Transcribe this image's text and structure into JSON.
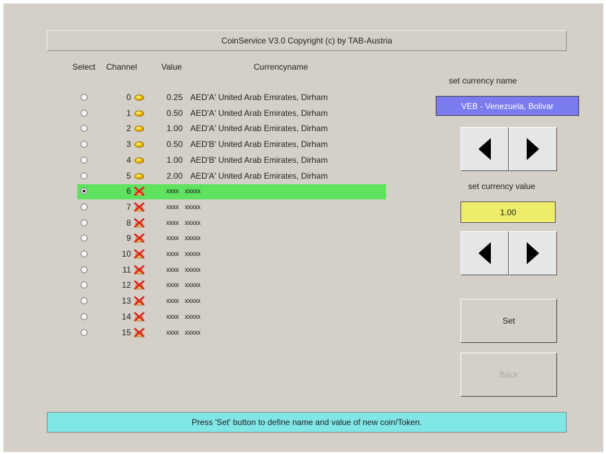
{
  "title": "CoinService V3.0 Copyright (c) by TAB-Austria",
  "columns": {
    "select": "Select",
    "channel": "Channel",
    "value": "Value",
    "currencyname": "Currencyname"
  },
  "selected_channel": 6,
  "channels": [
    {
      "channel": "0",
      "status": "coin",
      "value": "0.25",
      "currency": "AED'A' United Arab Emirates, Dirham"
    },
    {
      "channel": "1",
      "status": "coin",
      "value": "0.50",
      "currency": "AED'A' United Arab Emirates, Dirham"
    },
    {
      "channel": "2",
      "status": "coin",
      "value": "1.00",
      "currency": "AED'A' United Arab Emirates, Dirham"
    },
    {
      "channel": "3",
      "status": "coin",
      "value": "0.50",
      "currency": "AED'B' United Arab Emirates, Dirham"
    },
    {
      "channel": "4",
      "status": "coin",
      "value": "1.00",
      "currency": "AED'B' United Arab Emirates, Dirham"
    },
    {
      "channel": "5",
      "status": "coin",
      "value": "2.00",
      "currency": "AED'A' United Arab Emirates, Dirham"
    },
    {
      "channel": "6",
      "status": "empty",
      "value": "xxxx",
      "currency": "xxxxx"
    },
    {
      "channel": "7",
      "status": "empty",
      "value": "xxxx",
      "currency": "xxxxx"
    },
    {
      "channel": "8",
      "status": "empty",
      "value": "xxxx",
      "currency": "xxxxx"
    },
    {
      "channel": "9",
      "status": "empty",
      "value": "xxxx",
      "currency": "xxxxx"
    },
    {
      "channel": "10",
      "status": "empty",
      "value": "xxxx",
      "currency": "xxxxx"
    },
    {
      "channel": "11",
      "status": "empty",
      "value": "xxxx",
      "currency": "xxxxx"
    },
    {
      "channel": "12",
      "status": "empty",
      "value": "xxxx",
      "currency": "xxxxx"
    },
    {
      "channel": "13",
      "status": "empty",
      "value": "xxxx",
      "currency": "xxxxx"
    },
    {
      "channel": "14",
      "status": "empty",
      "value": "xxxx",
      "currency": "xxxxx"
    },
    {
      "channel": "15",
      "status": "empty",
      "value": "xxxx",
      "currency": "xxxxx"
    }
  ],
  "panel": {
    "set_name_label": "set currency name",
    "currency_name": "VEB - Venezuela, Bolivar",
    "set_value_label": "set currency value",
    "currency_value": "1.00",
    "set_button": "Set",
    "back_button": "Back"
  },
  "status_message": "Press 'Set' button to define name and value of new coin/Token.",
  "colors": {
    "background": "#d4d0c8",
    "selected_row": "#5fe35f",
    "name_box": "#7b7bf0",
    "value_box": "#eded6a",
    "status_bar": "#80e6e6"
  },
  "icons": {
    "coin": "gold-coin-icon",
    "empty": "red-x-icon"
  }
}
